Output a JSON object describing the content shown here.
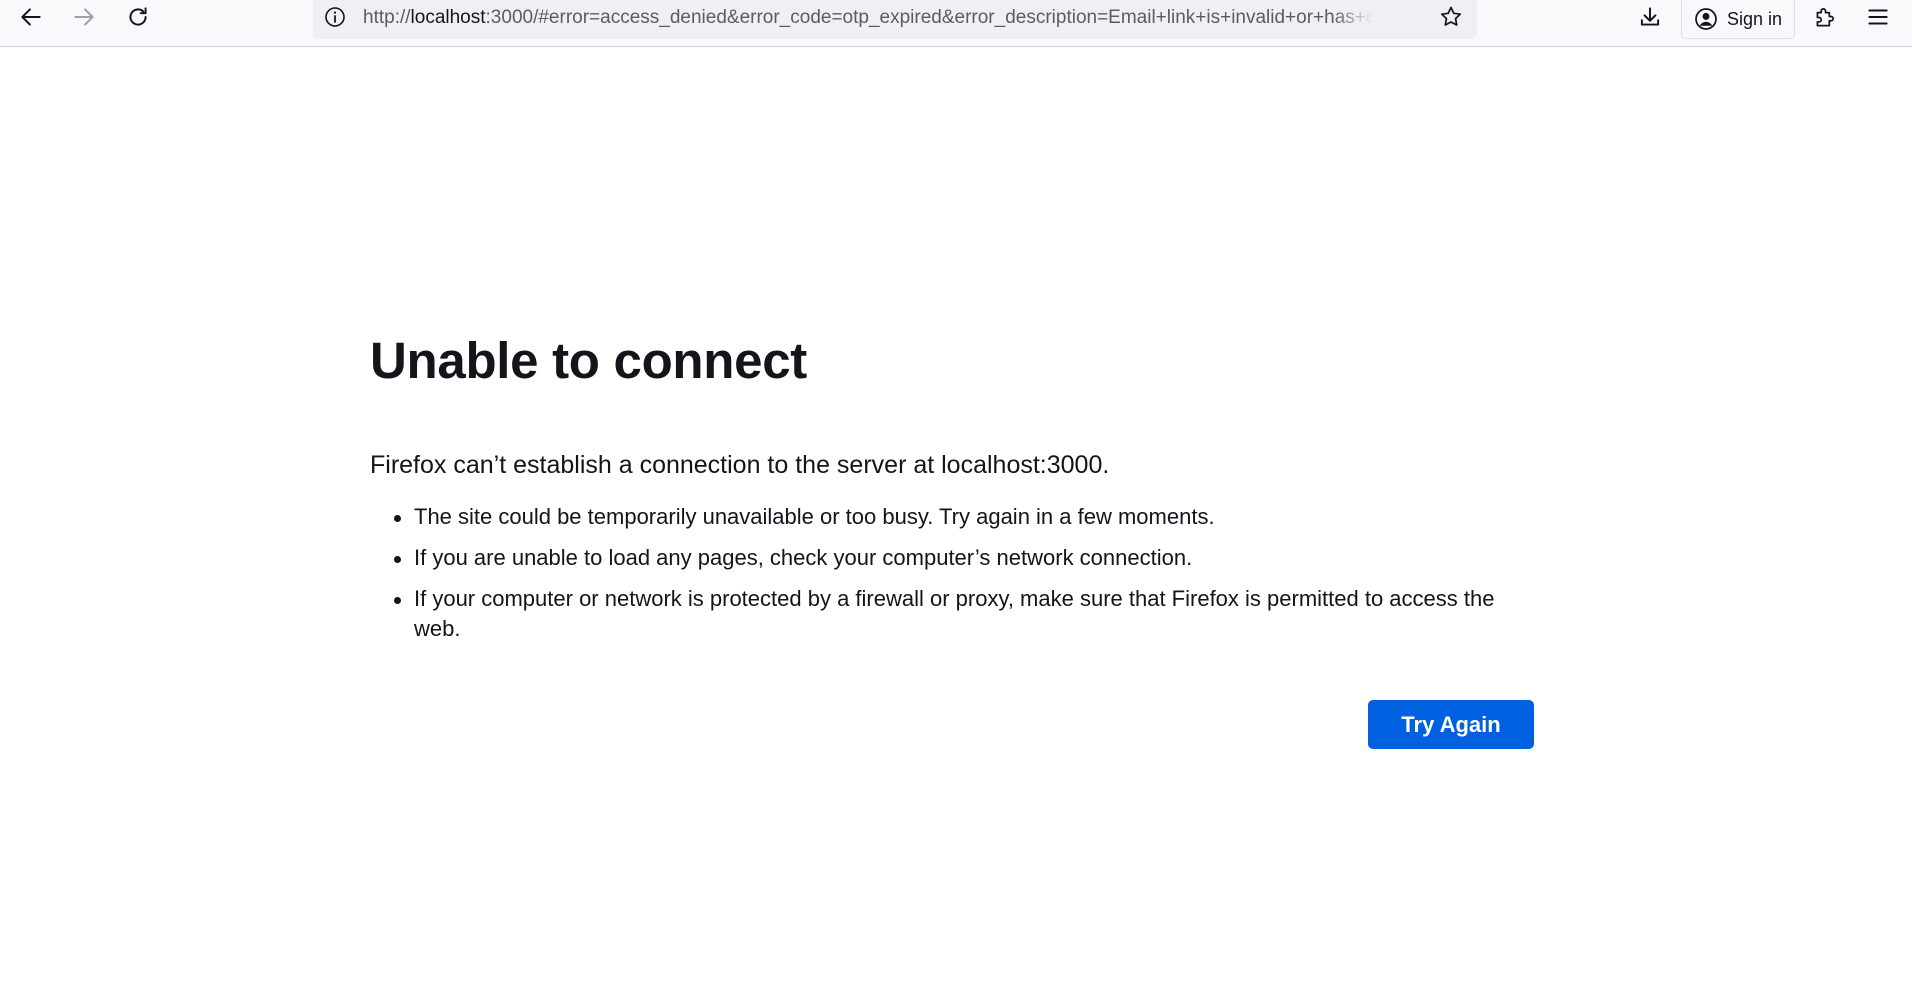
{
  "browser": {
    "url_prefix": "http://",
    "url_host": "localhost",
    "url_rest": ":3000/#error=access_denied&error_code=otp_expired&error_description=Email+link+is+invalid+or+has+expired",
    "signin_label": "Sign in",
    "icons": {
      "back": "back-arrow-icon",
      "forward": "forward-arrow-icon",
      "reload": "reload-icon",
      "site_info": "info-icon",
      "bookmark": "star-icon",
      "downloads": "download-icon",
      "account": "account-icon",
      "extensions": "puzzle-icon",
      "menu": "hamburger-menu-icon"
    }
  },
  "error": {
    "title": "Unable to connect",
    "description": "Firefox can’t establish a connection to the server at localhost:3000.",
    "suggestions": [
      "The site could be temporarily unavailable or too busy. Try again in a few moments.",
      "If you are unable to load any pages, check your computer’s network connection.",
      "If your computer or network is protected by a firewall or proxy, make sure that Firefox is permitted to access the web."
    ],
    "try_again_label": "Try Again"
  },
  "colors": {
    "accent": "#0061e0",
    "text": "#15141a",
    "toolbar_bg": "#f9f9fb",
    "urlbar_bg": "#f0f0f4"
  }
}
